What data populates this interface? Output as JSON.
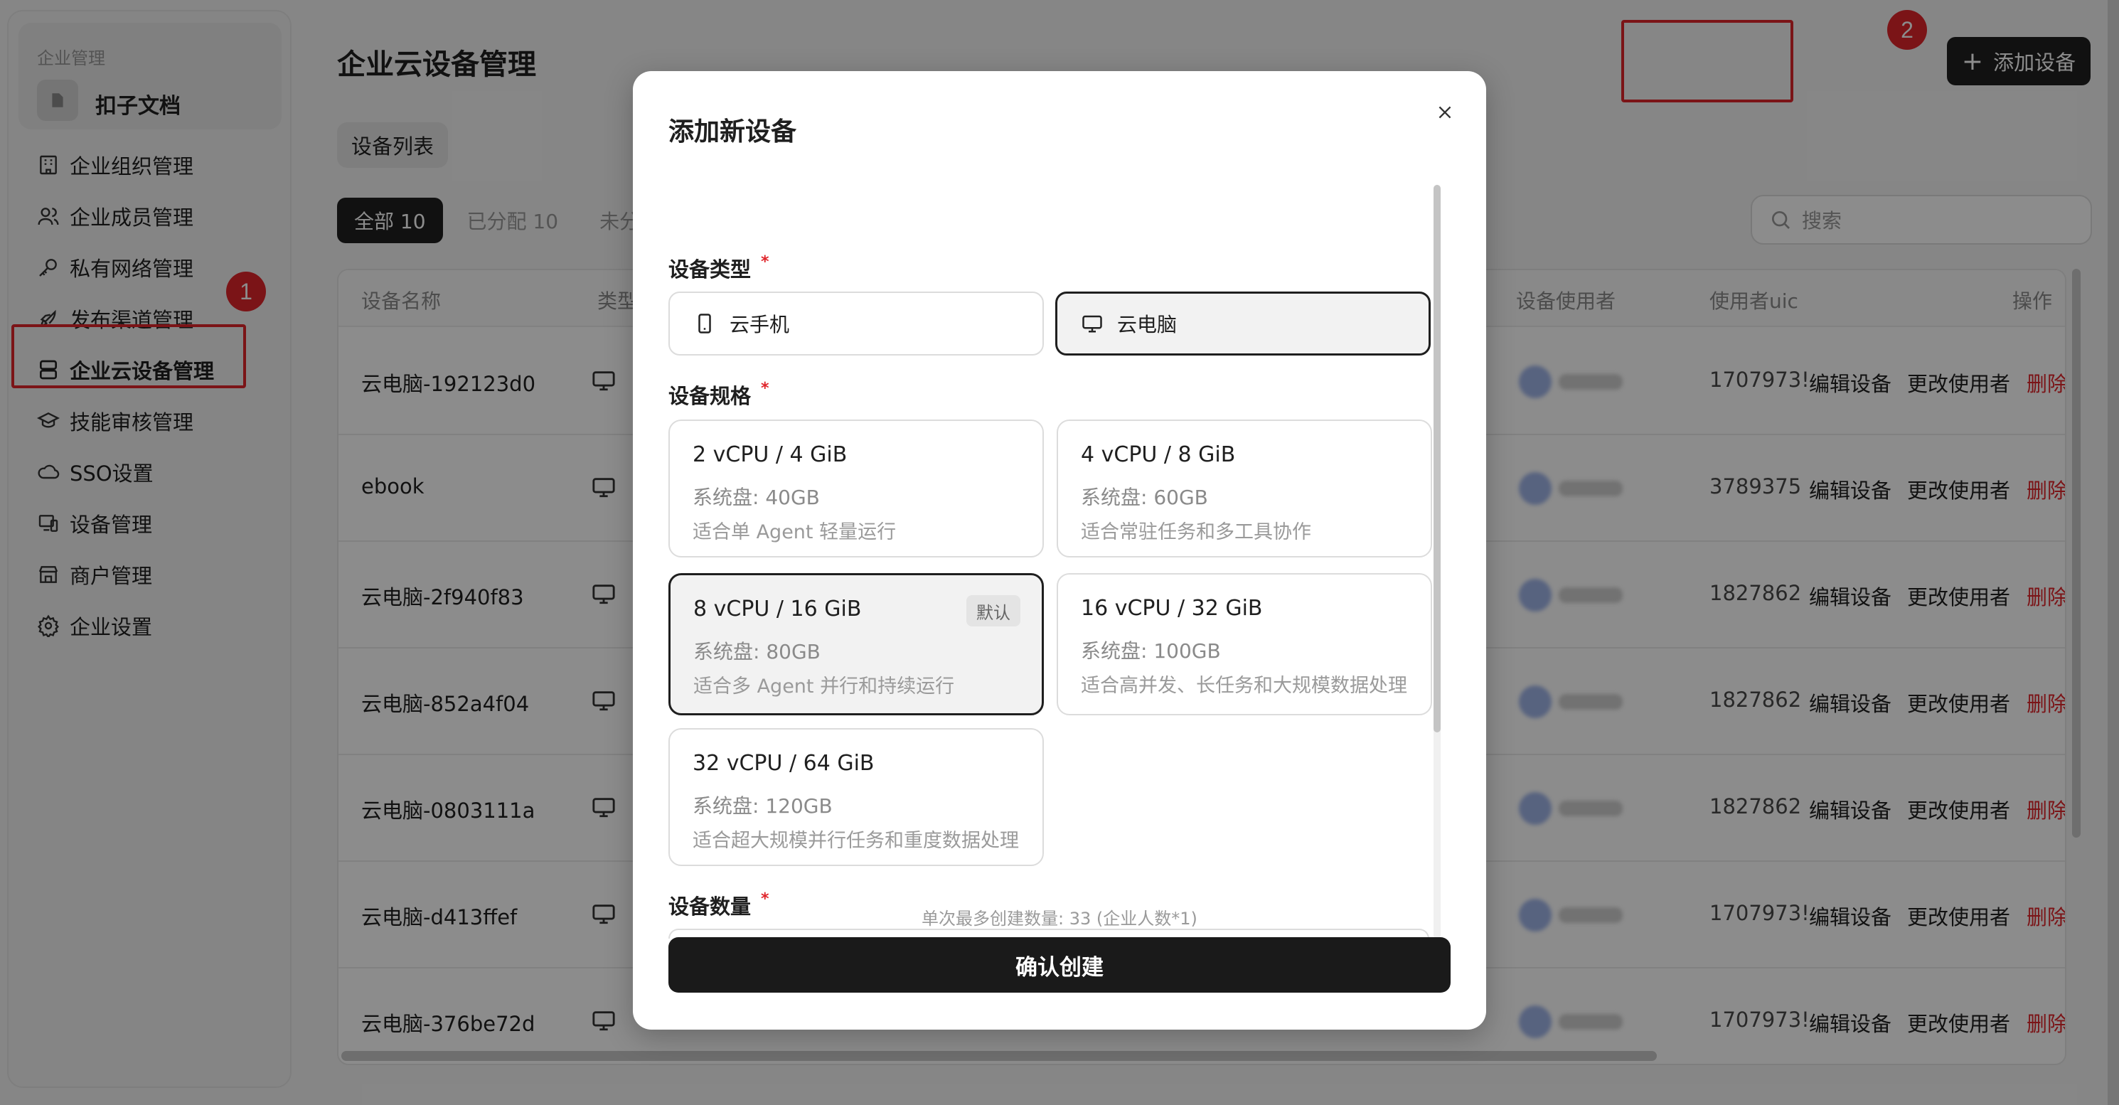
{
  "sidebar": {
    "org_label": "企业管理",
    "org_name": "扣子文档",
    "items": [
      {
        "label": "企业组织管理",
        "icon": "building-icon"
      },
      {
        "label": "企业成员管理",
        "icon": "users-icon"
      },
      {
        "label": "私有网络管理",
        "icon": "key-icon"
      },
      {
        "label": "发布渠道管理",
        "icon": "rocket-icon"
      },
      {
        "label": "企业云设备管理",
        "icon": "server-icon",
        "active": true
      },
      {
        "label": "技能审核管理",
        "icon": "graduation-cap-icon"
      },
      {
        "label": "SSO设置",
        "icon": "cloud-link-icon"
      },
      {
        "label": "设备管理",
        "icon": "devices-icon"
      },
      {
        "label": "商户管理",
        "icon": "store-icon"
      },
      {
        "label": "企业设置",
        "icon": "gear-icon"
      }
    ]
  },
  "annotations": {
    "badge1": "1",
    "badge2": "2",
    "highlight_color": "#e0252b"
  },
  "header": {
    "title": "企业云设备管理",
    "add_button": "添加设备",
    "add_button_icon": "+"
  },
  "tabs": {
    "list": "设备列表"
  },
  "filters": [
    "全部 10",
    "已分配 10",
    "未分"
  ],
  "search": {
    "placeholder": "搜索"
  },
  "table": {
    "columns": {
      "name": "设备名称",
      "type": "类型",
      "user": "设备使用者",
      "uid": "使用者uic",
      "ops": "操作"
    },
    "rows": [
      {
        "name": "云电脑-192123d0",
        "uid": "1707973!"
      },
      {
        "name": "ebook",
        "uid": "3789375"
      },
      {
        "name": "云电脑-2f940f83",
        "uid": "1827862"
      },
      {
        "name": "云电脑-852a4f04",
        "uid": "1827862"
      },
      {
        "name": "云电脑-0803111a",
        "uid": "1827862"
      },
      {
        "name": "云电脑-d413ffef",
        "uid": "1707973!"
      },
      {
        "name": "云电脑-376be72d",
        "uid": "1707973!"
      }
    ],
    "op_edit": "编辑设备",
    "op_change": "更改使用者",
    "op_delete": "删除"
  },
  "modal": {
    "title": "添加新设备",
    "type_label": "设备类型",
    "required_mark": "*",
    "types": [
      {
        "label": "云手机",
        "icon": "phone-icon"
      },
      {
        "label": "云电脑",
        "icon": "monitor-icon",
        "selected": true
      }
    ],
    "spec_label": "设备规格",
    "specs": [
      {
        "name": "2 vCPU / 4 GiB",
        "disk": "系统盘: 40GB",
        "desc": "适合单 Agent 轻量运行"
      },
      {
        "name": "4 vCPU / 8 GiB",
        "disk": "系统盘: 60GB",
        "desc": "适合常驻任务和多工具协作"
      },
      {
        "name": "8 vCPU / 16 GiB",
        "disk": "系统盘: 80GB",
        "desc": "适合多 Agent 并行和持续运行",
        "tag": "默认",
        "selected": true
      },
      {
        "name": "16 vCPU / 32 GiB",
        "disk": "系统盘: 100GB",
        "desc": "适合高并发、长任务和大规模数据处理"
      },
      {
        "name": "32 vCPU / 64 GiB",
        "disk": "系统盘: 120GB",
        "desc": "适合超大规模并行任务和重度数据处理"
      }
    ],
    "qty_label": "设备数量",
    "hint": "单次最多创建数量: 33 (企业人数*1)",
    "confirm": "确认创建"
  }
}
